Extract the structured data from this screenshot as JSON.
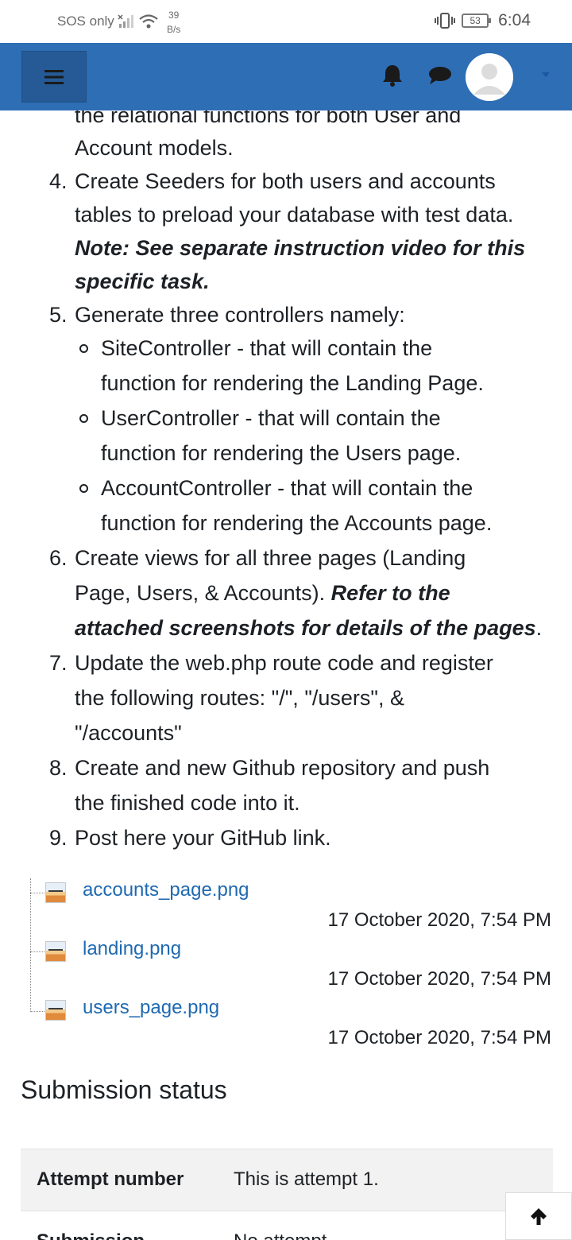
{
  "status_bar": {
    "carrier": "SOS only",
    "speed_value": "39",
    "speed_unit": "B/s",
    "battery": "53",
    "time": "6:04"
  },
  "navbar": {
    "color": "#2e6eb5",
    "menu_icon": "hamburger-icon",
    "bell_icon": "bell-icon",
    "chat_icon": "chat-icon",
    "avatar": "user-avatar"
  },
  "instructions": {
    "partial_line_1": "the relational functions for both User and",
    "partial_line_2": "Account models.",
    "step4": {
      "num": "4.",
      "line1": "Create Seeders for both users and accounts",
      "line2": "tables to preload your database with test data.",
      "note1": "Note: See separate instruction video for this",
      "note2": "specific task."
    },
    "step5": {
      "num": "5.",
      "line1": "Generate three controllers namely:",
      "sub": [
        {
          "line1": "SiteController - that will contain the",
          "line2": "function for rendering the Landing Page."
        },
        {
          "line1": "UserController - that will contain the",
          "line2": "function for rendering the Users page."
        },
        {
          "line1": "AccountController - that will contain the",
          "line2": "function for rendering the Accounts page."
        }
      ]
    },
    "step6": {
      "num": "6.",
      "line1": "Create views for all three pages (Landing",
      "line2_plain": "Page, Users, & Accounts). ",
      "line2_bold": "Refer to the",
      "line3_bold": "attached screenshots for details of the pages",
      "line3_end": "."
    },
    "step7": {
      "num": "7.",
      "line1": "Update the web.php route code and register",
      "line2": "the following routes: \"/\", \"/users\", &",
      "line3": "\"/accounts\""
    },
    "step8": {
      "num": "8.",
      "line1": "Create and new Github repository and push",
      "line2": "the finished code into it."
    },
    "step9": {
      "num": "9.",
      "line1": "Post here your GitHub link."
    }
  },
  "attachments": [
    {
      "name": "accounts_page.png",
      "date": "17 October 2020, 7:54 PM"
    },
    {
      "name": "landing.png",
      "date": "17 October 2020, 7:54 PM"
    },
    {
      "name": "users_page.png",
      "date": "17 October 2020, 7:54 PM"
    }
  ],
  "submission": {
    "title": "Submission status",
    "rows": [
      {
        "label": "Attempt number",
        "value": "This is attempt 1."
      },
      {
        "label": "Submission",
        "value": "No attempt"
      }
    ]
  },
  "back_to_top_icon": "arrow-up-icon"
}
